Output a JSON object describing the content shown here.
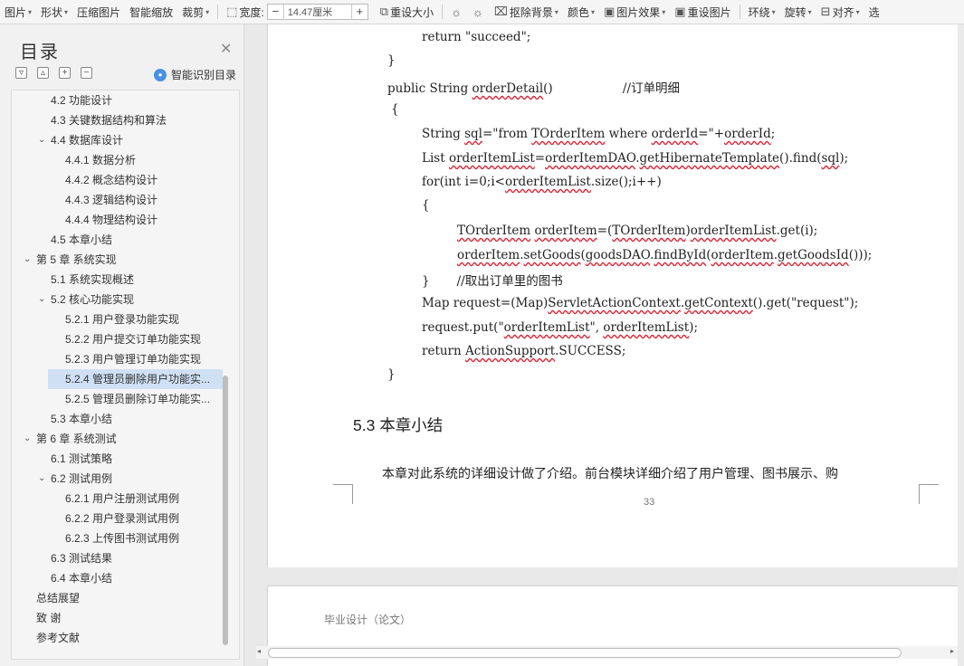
{
  "toolbar": {
    "items": [
      {
        "label": "图片",
        "dropdown": true
      },
      {
        "label": "形状",
        "dropdown": true
      },
      {
        "label": "压缩图片",
        "dropdown": false
      },
      {
        "label": "智能缩放",
        "dropdown": false
      },
      {
        "label": "裁剪",
        "dropdown": true
      }
    ],
    "width_label": "宽度:",
    "width_value": "14.47厘米",
    "width_minus": "−",
    "width_plus": "+",
    "reset_size": "重设大小",
    "remove_bg": "抠除背景",
    "color": "颜色",
    "picture_effect": "图片效果",
    "reset_picture": "重设图片",
    "wrap": "环绕",
    "rotate": "旋转",
    "align": "对齐",
    "more": "选"
  },
  "sidebar": {
    "title": "目录",
    "smart_toc": "智能识别目录",
    "tool_icons": [
      "collapse-all-icon",
      "expand-all-icon",
      "add-level-icon",
      "remove-level-icon"
    ],
    "items": [
      {
        "label": "4.2  功能设计",
        "level": 2,
        "arrow": false,
        "selected": false
      },
      {
        "label": "4.3  关键数据结构和算法",
        "level": 2,
        "arrow": false,
        "selected": false
      },
      {
        "label": "4.4  数据库设计",
        "level": 2,
        "arrow": true,
        "selected": false
      },
      {
        "label": "4.4.1  数据分析",
        "level": 3,
        "arrow": false,
        "selected": false
      },
      {
        "label": "4.4.2  概念结构设计",
        "level": 3,
        "arrow": false,
        "selected": false
      },
      {
        "label": "4.4.3  逻辑结构设计",
        "level": 3,
        "arrow": false,
        "selected": false
      },
      {
        "label": "4.4.4  物理结构设计",
        "level": 3,
        "arrow": false,
        "selected": false
      },
      {
        "label": "4.5  本章小结",
        "level": 2,
        "arrow": false,
        "selected": false
      },
      {
        "label": "第 5 章    系统实现",
        "level": 1,
        "arrow": true,
        "selected": false
      },
      {
        "label": "5.1  系统实现概述",
        "level": 2,
        "arrow": false,
        "selected": false
      },
      {
        "label": "5.2  核心功能实现",
        "level": 2,
        "arrow": true,
        "selected": false
      },
      {
        "label": "5.2.1  用户登录功能实现",
        "level": 3,
        "arrow": false,
        "selected": false
      },
      {
        "label": "5.2.2  用户提交订单功能实现",
        "level": 3,
        "arrow": false,
        "selected": false
      },
      {
        "label": "5.2.3  用户管理订单功能实现",
        "level": 3,
        "arrow": false,
        "selected": false
      },
      {
        "label": "5.2.4  管理员删除用户功能实...",
        "level": 3,
        "arrow": false,
        "selected": true
      },
      {
        "label": "5.2.5  管理员删除订单功能实...",
        "level": 3,
        "arrow": false,
        "selected": false
      },
      {
        "label": "5.3  本章小结",
        "level": 2,
        "arrow": false,
        "selected": false
      },
      {
        "label": "第 6 章    系统测试",
        "level": 1,
        "arrow": true,
        "selected": false
      },
      {
        "label": "6.1  测试策略",
        "level": 2,
        "arrow": false,
        "selected": false
      },
      {
        "label": "6.2  测试用例",
        "level": 2,
        "arrow": true,
        "selected": false
      },
      {
        "label": "6.2.1  用户注册测试用例",
        "level": 3,
        "arrow": false,
        "selected": false
      },
      {
        "label": "6.2.2  用户登录测试用例",
        "level": 3,
        "arrow": false,
        "selected": false
      },
      {
        "label": "6.2.3  上传图书测试用例",
        "level": 3,
        "arrow": false,
        "selected": false
      },
      {
        "label": "6.3  测试结果",
        "level": 2,
        "arrow": false,
        "selected": false
      },
      {
        "label": "6.4  本章小结",
        "level": 2,
        "arrow": false,
        "selected": false
      },
      {
        "label": "总结展望",
        "level": 0,
        "arrow": false,
        "selected": false
      },
      {
        "label": "致        谢",
        "level": 0,
        "arrow": false,
        "selected": false
      },
      {
        "label": "参考文献",
        "level": 0,
        "arrow": false,
        "selected": false
      }
    ]
  },
  "document": {
    "code_lines": [
      [
        {
          "t": "return \"succeed\";"
        }
      ],
      [
        {
          "t": "}"
        }
      ],
      [
        {
          "t": "public String "
        },
        {
          "t": "orderDetail",
          "sq": true
        },
        {
          "t": "()                  //订单明细"
        }
      ],
      [
        {
          "t": "{"
        }
      ],
      [
        {
          "t": "String "
        },
        {
          "t": "sql",
          "sq": true
        },
        {
          "t": "=\"from "
        },
        {
          "t": "TOrderItem",
          "sq": true
        },
        {
          "t": " where "
        },
        {
          "t": "orderId",
          "sq": true
        },
        {
          "t": "=\"+"
        },
        {
          "t": "orderId",
          "sq": true
        },
        {
          "t": ";"
        }
      ],
      [
        {
          "t": "List "
        },
        {
          "t": "orderItemList",
          "sq": true
        },
        {
          "t": "="
        },
        {
          "t": "orderItemDAO",
          "sq": true
        },
        {
          "t": "."
        },
        {
          "t": "getHibernateTemplate",
          "sq": true
        },
        {
          "t": "().find("
        },
        {
          "t": "sql",
          "sq": true
        },
        {
          "t": ");"
        }
      ],
      [
        {
          "t": "for(int i=0;i<"
        },
        {
          "t": "orderItemList",
          "sq": true
        },
        {
          "t": ".size();i++)"
        }
      ],
      [
        {
          "t": "{"
        }
      ],
      [
        {
          "t": "TOrderItem",
          "sq": true
        },
        {
          "t": " "
        },
        {
          "t": "orderItem",
          "sq": true
        },
        {
          "t": "=("
        },
        {
          "t": "TOrderItem",
          "sq": true
        },
        {
          "t": ")"
        },
        {
          "t": "orderItemList",
          "sq": true
        },
        {
          "t": ".get(i);"
        }
      ],
      [
        {
          "t": "orderItem",
          "sq": true
        },
        {
          "t": "."
        },
        {
          "t": "setGoods",
          "sq": true
        },
        {
          "t": "("
        },
        {
          "t": "goodsDAO",
          "sq": true
        },
        {
          "t": "."
        },
        {
          "t": "findById",
          "sq": true
        },
        {
          "t": "("
        },
        {
          "t": "orderItem",
          "sq": true
        },
        {
          "t": "."
        },
        {
          "t": "getGoodsId",
          "sq": true
        },
        {
          "t": "()));"
        }
      ],
      [
        {
          "t": "}       //取出订单里的图书"
        }
      ],
      [
        {
          "t": "Map request=(Map)"
        },
        {
          "t": "ServletActionContext",
          "sq": true
        },
        {
          "t": "."
        },
        {
          "t": "getContext",
          "sq": true
        },
        {
          "t": "().get(\"request\");"
        }
      ],
      [
        {
          "t": "request.put(\""
        },
        {
          "t": "orderItemList",
          "sq": true
        },
        {
          "t": "\", "
        },
        {
          "t": "orderItemList",
          "sq": true
        },
        {
          "t": ");"
        }
      ],
      [
        {
          "t": "return "
        },
        {
          "t": "ActionSupport",
          "sq": true
        },
        {
          "t": ".SUCCESS;"
        }
      ],
      [
        {
          "t": "}"
        }
      ]
    ],
    "heading": "5.3  本章小结",
    "paragraph": "本章对此系统的详细设计做了介绍。前台模块详细介绍了用户管理、图书展示、购",
    "page_number": "33",
    "next_page_header": "毕业设计（论文）"
  }
}
